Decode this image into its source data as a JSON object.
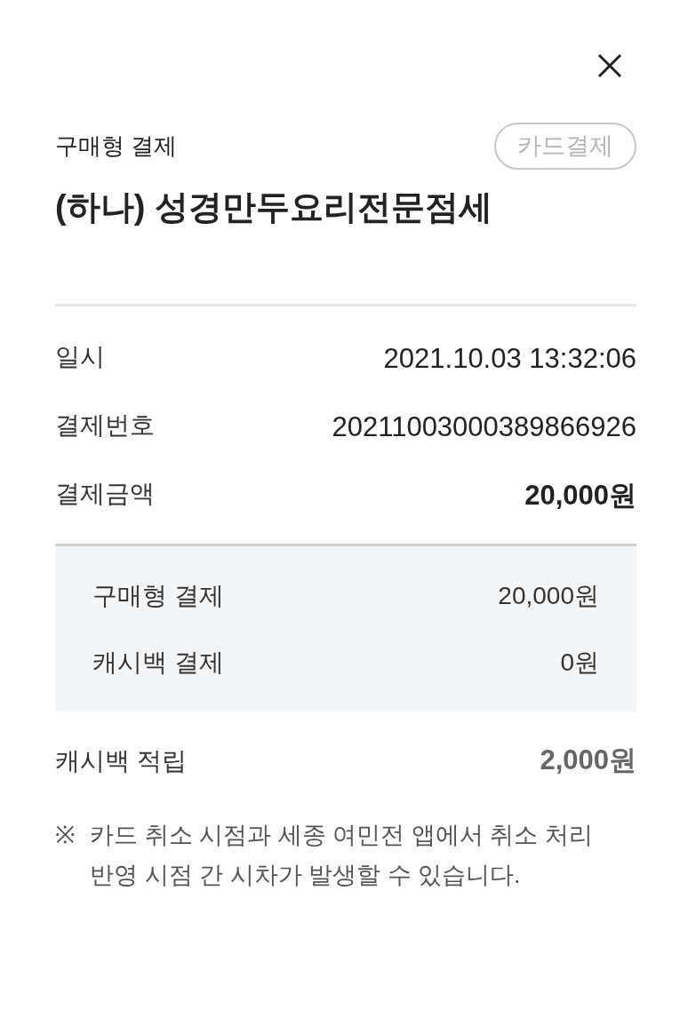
{
  "header": {
    "label": "구매형 결제",
    "badge": "카드결제"
  },
  "title": "(하나) 성경만두요리전문점세",
  "details": [
    {
      "label": "일시",
      "value": "2021.10.03 13:32:06",
      "emphasis": false
    },
    {
      "label": "결제번호",
      "value": "20211003000389866926",
      "emphasis": false
    },
    {
      "label": "결제금액",
      "value": "20,000원",
      "emphasis": true
    }
  ],
  "breakdown": [
    {
      "label": "구매형 결제",
      "value": "20,000원"
    },
    {
      "label": "캐시백 결제",
      "value": "0원"
    }
  ],
  "cashback": {
    "label": "캐시백 적립",
    "value": "2,000원"
  },
  "note": {
    "mark": "※",
    "text": "카드 취소 시점과 세종 여민전 앱에서 취소 처리 반영 시점 간 시차가 발생할 수 있습니다."
  }
}
